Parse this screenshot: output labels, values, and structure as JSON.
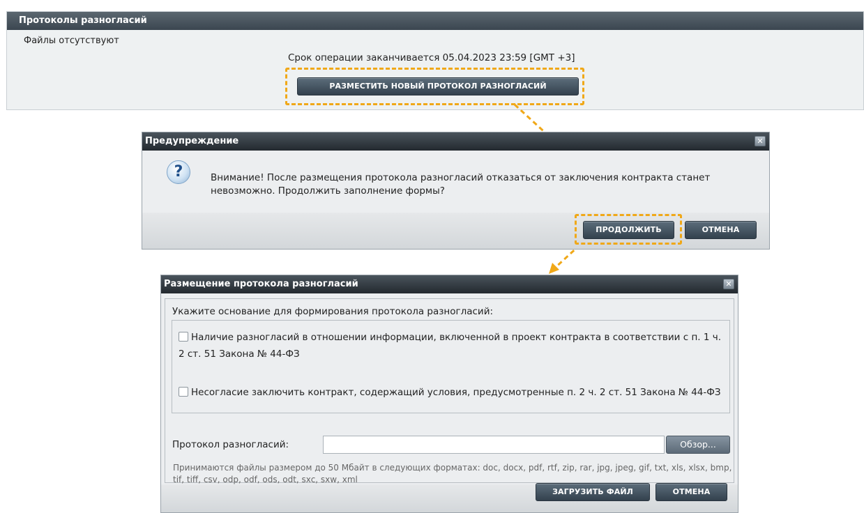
{
  "panel": {
    "title": "Протоколы разногласий",
    "no_files": "Файлы отсутствуют",
    "deadline": "Срок операции заканчивается 05.04.2023 23:59 [GMT +3]",
    "place_button": "РАЗМЕСТИТЬ НОВЫЙ ПРОТОКОЛ РАЗНОГЛАСИЙ"
  },
  "warning_dialog": {
    "title": "Предупреждение",
    "message": "Внимание! После размещения протокола разногласий отказаться от заключения контракта станет невозможно. Продолжить заполнение формы?",
    "continue_button": "ПРОДОЛЖИТЬ",
    "cancel_button": "ОТМЕНА",
    "close_glyph": "✕"
  },
  "upload_dialog": {
    "title": "Размещение протокола разногласий",
    "instruction": "Укажите основание для формирования протокола разногласий:",
    "options": [
      {
        "label": "Наличие разногласий в отношении информации, включенной в проект контракта в соответствии с п. 1 ч. 2 ст. 51 Закона № 44-ФЗ",
        "checked": false
      },
      {
        "label": "Несогласие заключить контракт, содержащий условия, предусмотренные п. 2 ч. 2 ст. 51 Закона № 44-ФЗ",
        "checked": false
      }
    ],
    "file_label": "Протокол разногласий:",
    "file_value": "",
    "browse_button": "Обзор...",
    "hint": "Принимаются файлы размером до 50 Мбайт в следующих форматах: doc, docx, pdf, rtf, zip, rar, jpg, jpeg, gif, txt, xls, xlsx, bmp, tif, tiff, csv, odp, odf, ods, odt, sxc, sxw, xml",
    "upload_button": "ЗАГРУЗИТЬ ФАЙЛ",
    "cancel_button": "ОТМЕНА",
    "close_glyph": "✕"
  },
  "colors": {
    "highlight": "#f0a818",
    "title_bar": "#2f373e",
    "button": "#3f4f5c"
  },
  "icons": {
    "question": "?"
  }
}
